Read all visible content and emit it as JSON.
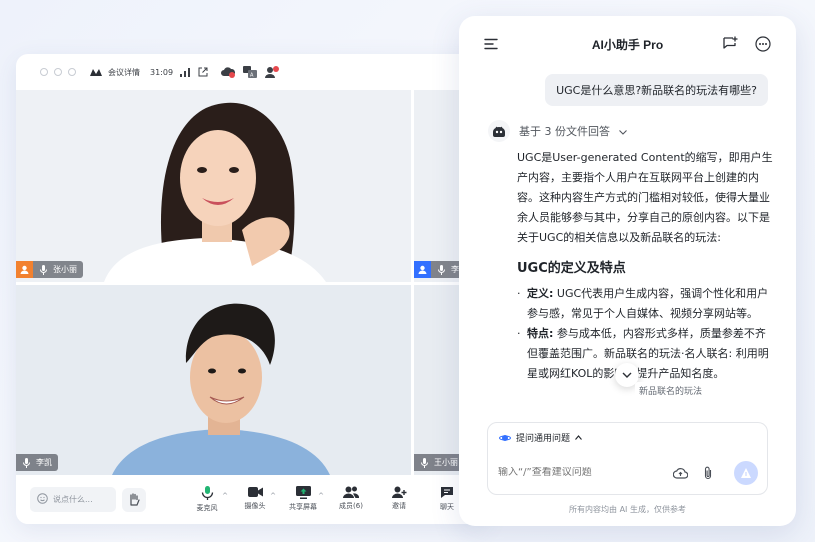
{
  "meeting": {
    "title_label": "会议详情",
    "duration": "31:09",
    "toolbar": {
      "chat_placeholder": "说点什么...",
      "buttons": [
        {
          "label": "麦克风",
          "icon": "mic-icon",
          "has_caret": true
        },
        {
          "label": "摄像头",
          "icon": "camera-icon",
          "has_caret": true
        },
        {
          "label": "共享屏幕",
          "icon": "share-screen-icon",
          "has_caret": true
        },
        {
          "label": "成员(6)",
          "icon": "members-icon",
          "has_caret": false
        },
        {
          "label": "邀请",
          "icon": "invite-icon",
          "has_caret": false
        },
        {
          "label": "聊天",
          "icon": "chat-icon",
          "has_caret": false
        }
      ]
    },
    "participants": [
      {
        "name": "张小丽",
        "host": true
      },
      {
        "name": "李",
        "host": true
      },
      {
        "name": "李凯",
        "host": false
      },
      {
        "name": "王小丽",
        "host": false
      }
    ]
  },
  "assistant": {
    "title": "AI小助手 Pro",
    "user_question": "UGC是什么意思?新品联名的玩法有哪些?",
    "source_note": "基于 3 份文件回答",
    "answer_intro": "UGC是User-generated Content的缩写，即用户生产内容，主要指个人用户在互联网平台上创建的内容。这种内容生产方式的门槛相对较低，使得大量业余人员能够参与其中，分享自己的原创内容。以下是关于UGC的相关信息以及新品联名的玩法:",
    "section_title": "UGC的定义及特点",
    "bullets": [
      {
        "term": "定义:",
        "text": "UGC代表用户生成内容，强调个性化和用户参与感，常见于个人自媒体、视频分享网站等。"
      },
      {
        "term": "特点:",
        "text": "参与成本低，内容形式多样，质量参差不齐但覆盖范围广。新品联名的玩法·名人联名: 利用明星或网红KOL的影响力提升产品知名度。"
      }
    ],
    "floating_tag": "新品联名的玩法",
    "suggest_label": "提问通用问题",
    "input_placeholder": "输入“/”查看建议问题",
    "footnote": "所有内容均由 AI 生成，仅供参考"
  }
}
